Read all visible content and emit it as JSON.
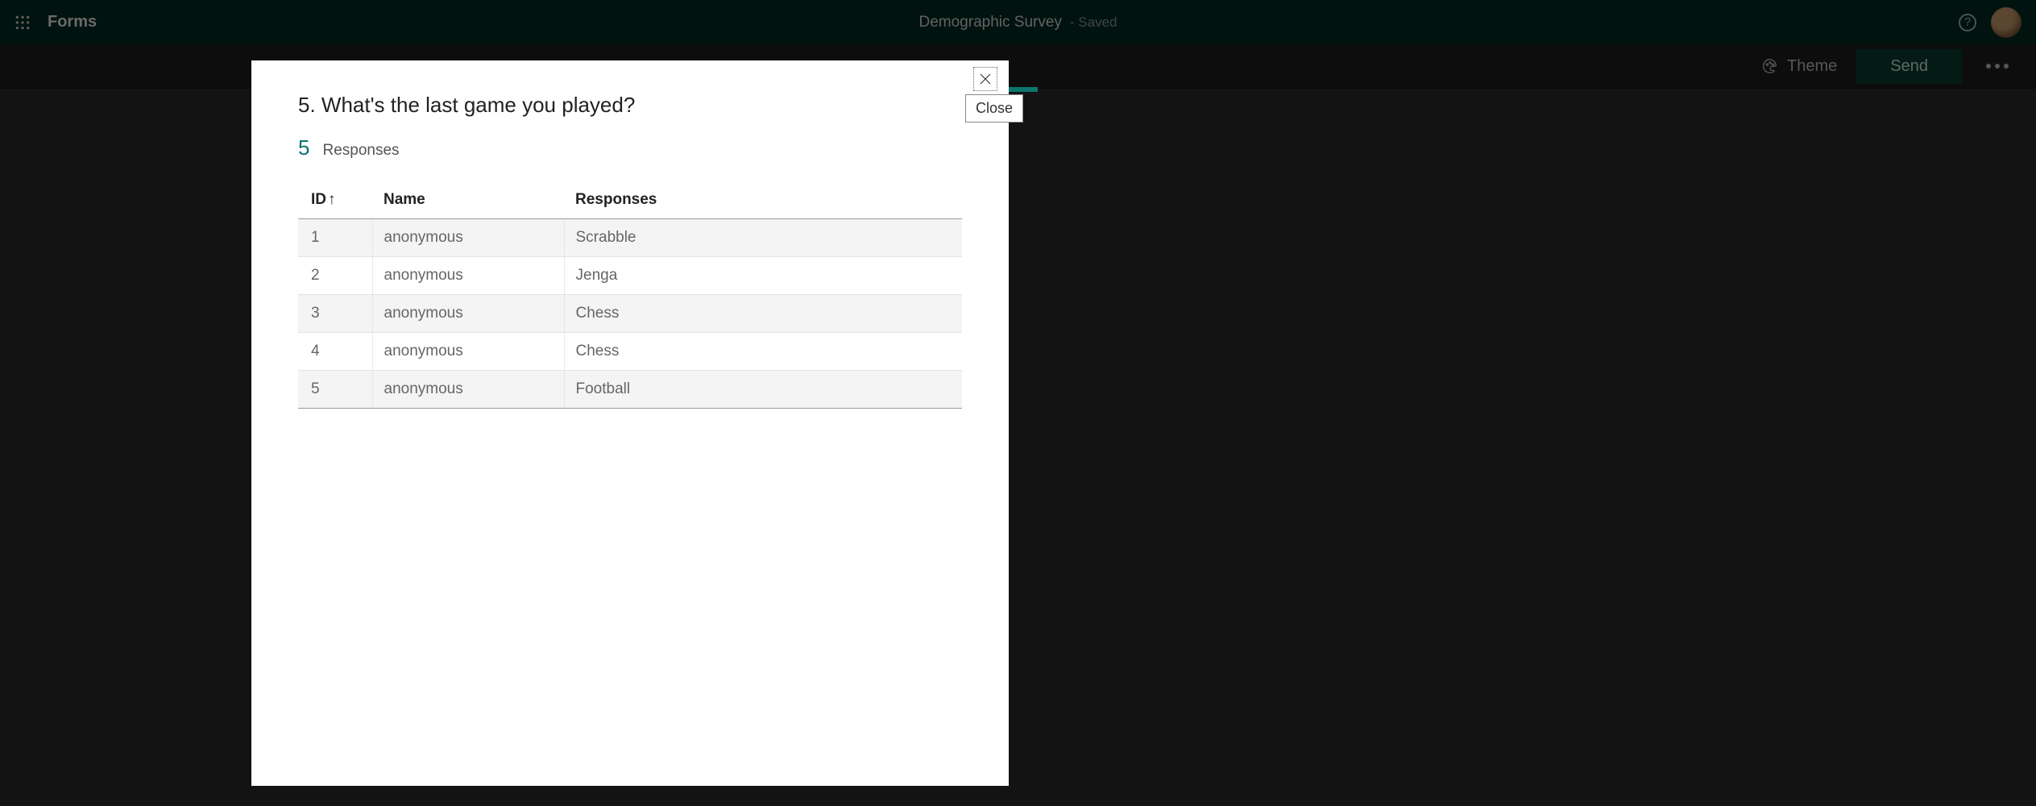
{
  "header": {
    "app_name": "Forms",
    "doc_title": "Demographic Survey",
    "doc_status": "Saved"
  },
  "cmdbar": {
    "theme_label": "Theme",
    "send_label": "Send"
  },
  "modal": {
    "close_tooltip": "Close",
    "question_title": "5. What's the last game you played?",
    "response_count": "5",
    "response_count_label": "Responses",
    "columns": {
      "id": "ID",
      "name": "Name",
      "responses": "Responses"
    },
    "rows": [
      {
        "id": "1",
        "name": "anonymous",
        "response": "Scrabble"
      },
      {
        "id": "2",
        "name": "anonymous",
        "response": "Jenga"
      },
      {
        "id": "3",
        "name": "anonymous",
        "response": "Chess"
      },
      {
        "id": "4",
        "name": "anonymous",
        "response": "Chess"
      },
      {
        "id": "5",
        "name": "anonymous",
        "response": "Football"
      }
    ]
  }
}
